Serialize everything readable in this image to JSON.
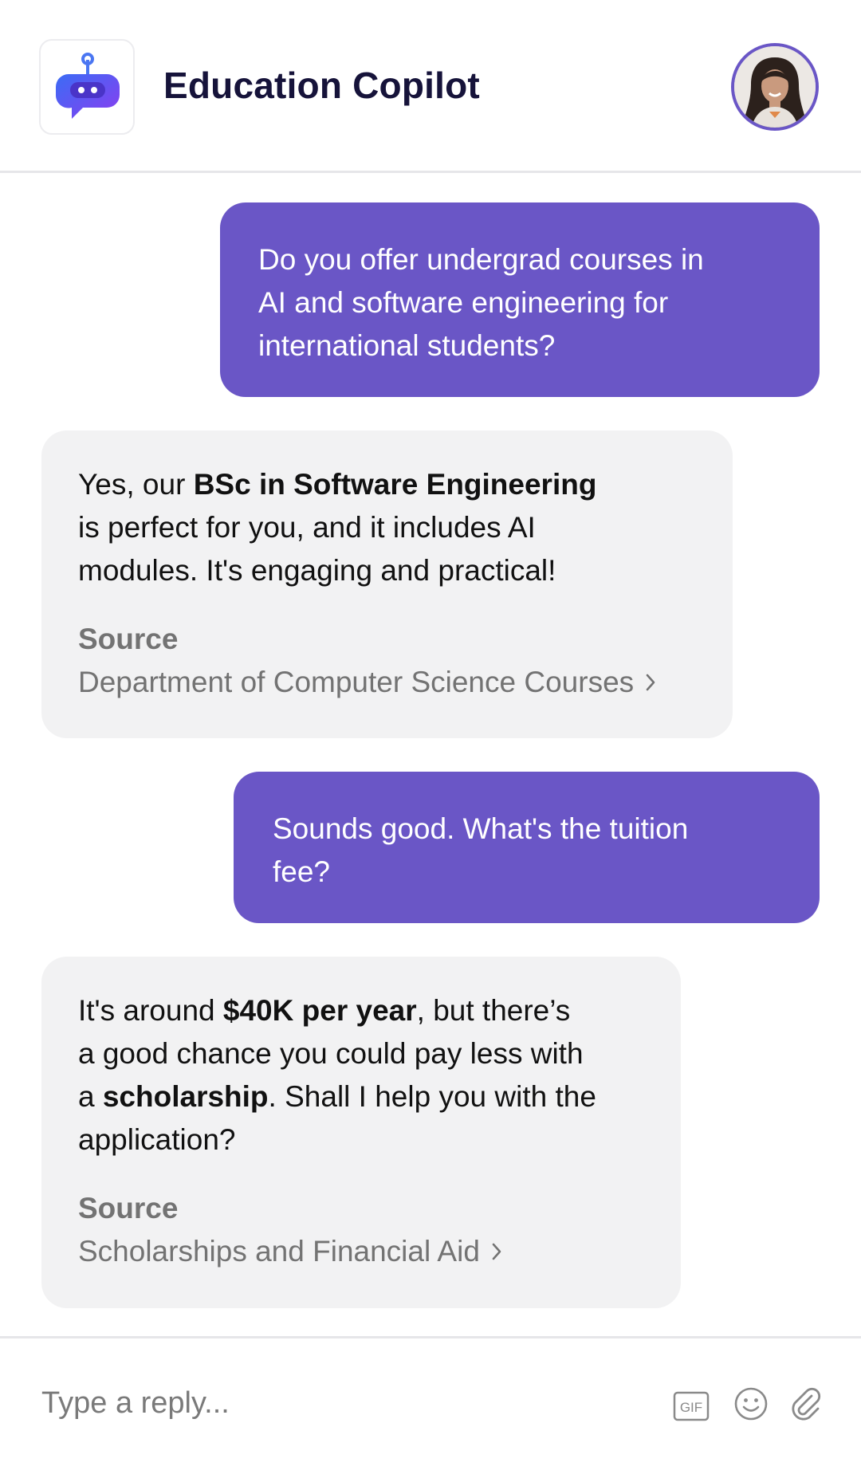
{
  "header": {
    "title": "Education Copilot",
    "logo_icon": "robot-chat-icon",
    "avatar": "user-avatar"
  },
  "messages": [
    {
      "role": "user",
      "lines": [
        "Do you offer undergrad courses in",
        "AI and software engineering for",
        "international students?"
      ]
    },
    {
      "role": "bot",
      "line1_pre": "Yes, our ",
      "line1_bold": "BSc in Software Engineering",
      "line2": "is perfect for you, and it includes AI",
      "line3": "modules. It's engaging and practical!",
      "source_label": "Source",
      "source_link": "Department of Computer Science Courses"
    },
    {
      "role": "user",
      "lines": [
        "Sounds good. What's the tuition",
        "fee?"
      ]
    },
    {
      "role": "bot",
      "line1_pre": "It's around ",
      "line1_bold": "$40K per year",
      "line1_post": ", but there’s",
      "line2": "a good chance you could pay less with",
      "line3_pre": "a ",
      "line3_bold": "scholarship",
      "line3_post": ". Shall I help you with the",
      "line4": "application?",
      "source_label": "Source",
      "source_link": "Scholarships and Financial Aid"
    }
  ],
  "composer": {
    "placeholder": "Type a reply...",
    "gif_label": "GIF",
    "icons": [
      "gif-icon",
      "emoji-icon",
      "paperclip-icon"
    ]
  },
  "colors": {
    "accent": "#6a56c6",
    "bot_bubble": "#f2f2f3",
    "title": "#16133a",
    "muted": "#737373"
  }
}
